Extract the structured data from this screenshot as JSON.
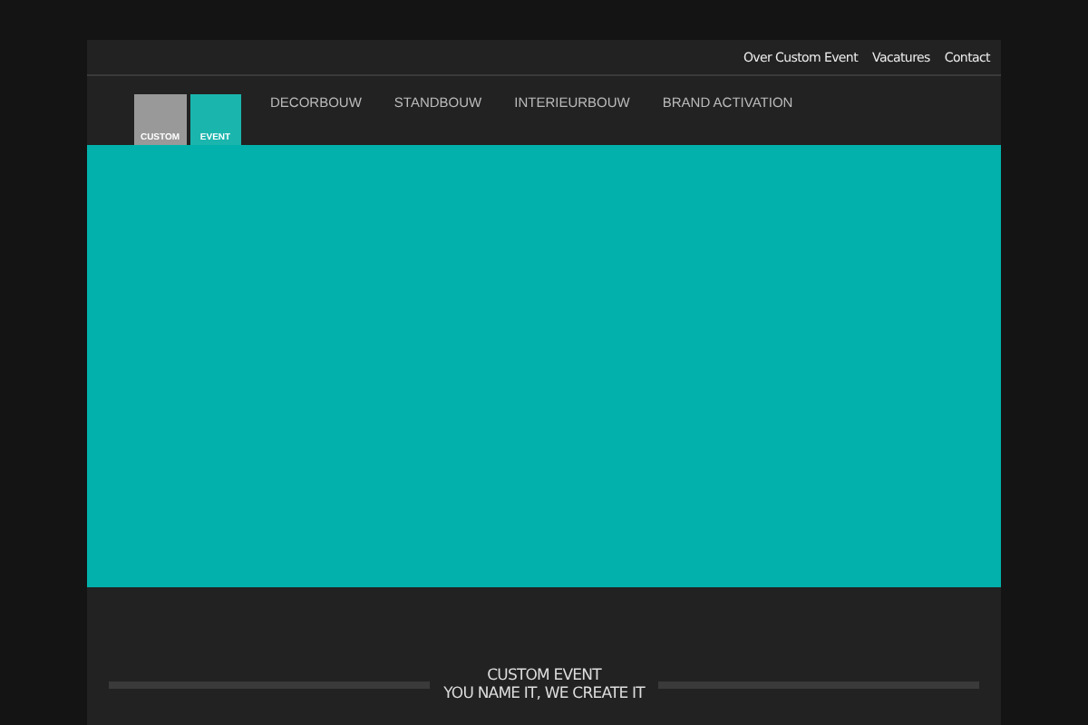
{
  "top_links": [
    "Over Custom Event",
    "Vacatures",
    "Contact"
  ],
  "logo": {
    "left_word": "CUSTOM",
    "right_word": "EVENT"
  },
  "nav": [
    "DECORBOUW",
    "STANDBOUW",
    "INTERIEURBOUW",
    "BRAND ACTIVATION"
  ],
  "tagline": {
    "title": "CUSTOM EVENT",
    "subtitle": "YOU NAME IT, WE CREATE IT"
  }
}
